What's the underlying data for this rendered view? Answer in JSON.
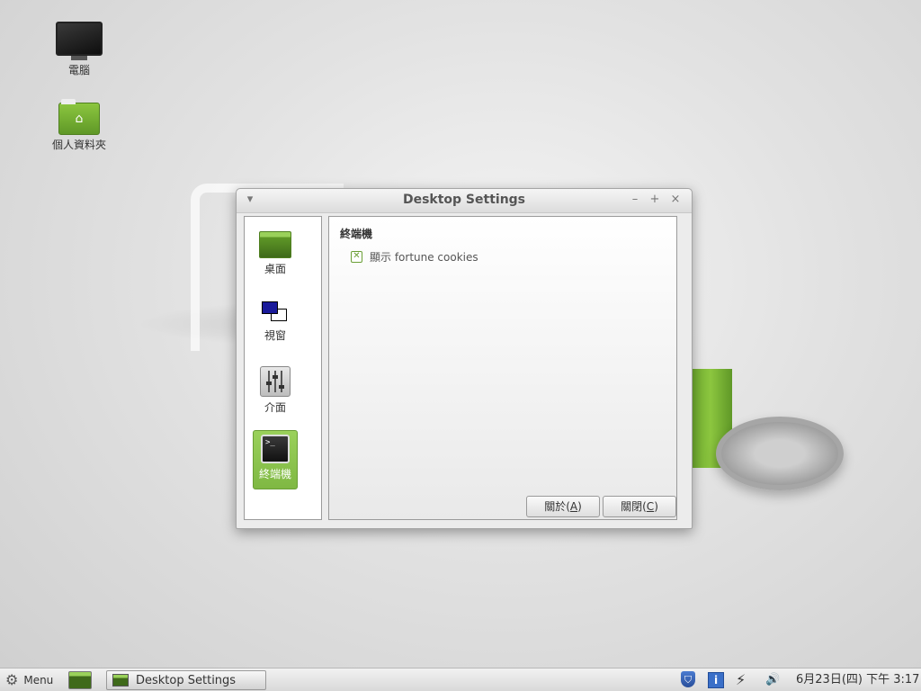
{
  "desktop": {
    "icons": [
      {
        "label": "電腦"
      },
      {
        "label": "個人資料夾"
      }
    ]
  },
  "window": {
    "title": "Desktop Settings",
    "controls": {
      "menu": "▾",
      "minimize": "–",
      "maximize": "+",
      "close": "×"
    },
    "sidebar": {
      "items": [
        {
          "label": "桌面",
          "active": false
        },
        {
          "label": "視窗",
          "active": false
        },
        {
          "label": "介面",
          "active": false
        },
        {
          "label": "終端機",
          "active": true
        }
      ]
    },
    "content": {
      "section_title": "終端機",
      "checkbox_label": "顯示 fortune cookies",
      "checkbox_checked": true
    },
    "buttons": {
      "about": {
        "text": "關於(",
        "mnemonic": "A",
        "suffix": ")"
      },
      "close": {
        "text": "關閉(",
        "mnemonic": "C",
        "suffix": ")"
      }
    }
  },
  "taskbar": {
    "menu_label": "Menu",
    "task_label": "Desktop Settings",
    "datetime": "6月23日(四) 下午  3:17"
  },
  "colors": {
    "accent_green": "#8cc63f",
    "window_bg": "#ececec"
  }
}
